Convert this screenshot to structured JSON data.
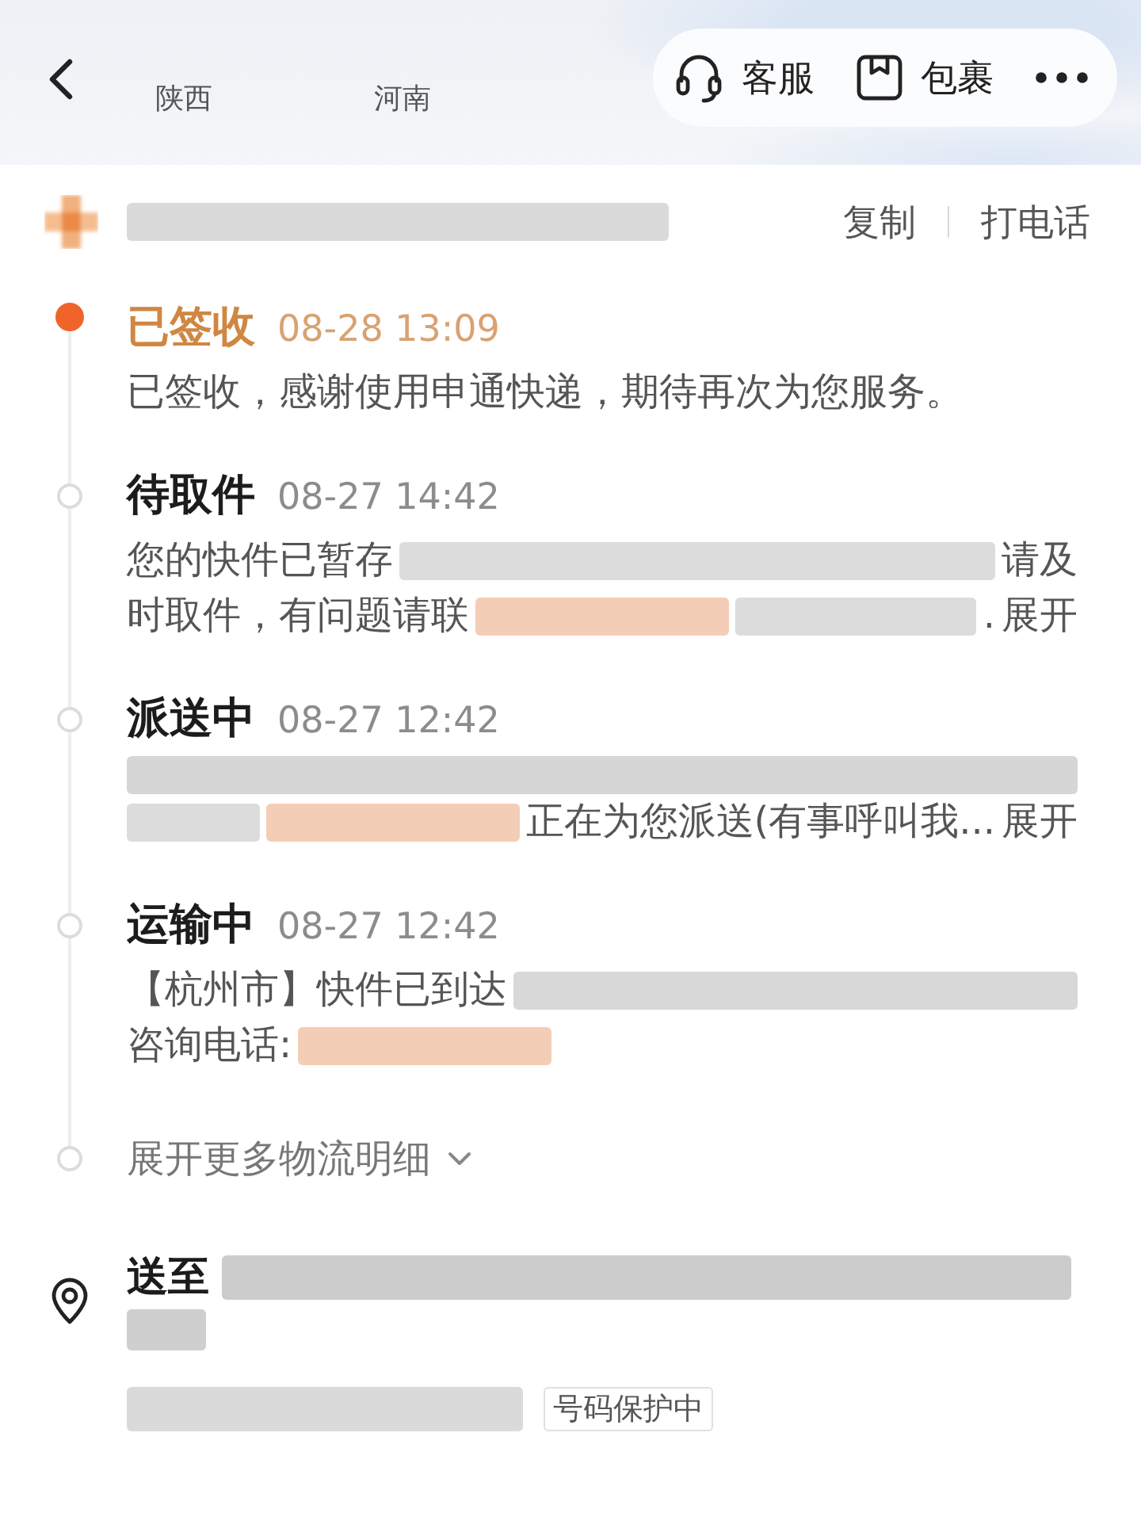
{
  "map": {
    "labels": [
      "陕西",
      "河南"
    ]
  },
  "top_bar": {
    "actions": [
      {
        "kind": "headset",
        "label": "客服"
      },
      {
        "kind": "package",
        "label": "包裹"
      }
    ]
  },
  "waybill": {
    "number": [
      {
        "kind": "blur-fill",
        "color": "#dadada"
      }
    ],
    "actions": [
      "复制",
      "打电话"
    ]
  },
  "timeline": [
    {
      "status": "已签收",
      "time": "08-28 13:09",
      "current": true,
      "lines": [
        [
          {
            "kind": "text",
            "text": "已签收，感谢使用申通快递，期待再次为您服务。"
          }
        ]
      ]
    },
    {
      "status": "待取件",
      "time": "08-27 14:42",
      "current": false,
      "lines": [
        [
          {
            "kind": "text",
            "text": "您的快件已暂存"
          },
          {
            "kind": "blur-fill",
            "color": "#dcdcdc"
          },
          {
            "kind": "text",
            "text": "请及"
          }
        ],
        [
          {
            "kind": "text",
            "text": "时取件，有问题请联"
          },
          {
            "kind": "blur-medium",
            "color": "#f4cdb6"
          },
          {
            "kind": "blur-fill",
            "color": "#dcdcdc"
          },
          {
            "kind": "text",
            "text": "."
          },
          {
            "kind": "link",
            "text": "展开"
          }
        ]
      ]
    },
    {
      "status": "派送中",
      "time": "08-27 12:42",
      "current": false,
      "lines": [
        [
          {
            "kind": "blur-fill",
            "color": "#d6d6d6"
          }
        ],
        [
          {
            "kind": "blur-fill",
            "color": "#dcdcdc"
          },
          {
            "kind": "blur-medium",
            "color": "#f4cdb6"
          },
          {
            "kind": "text",
            "text": "正在为您派送(有事呼叫我..."
          },
          {
            "kind": "link",
            "text": "展开"
          }
        ]
      ]
    },
    {
      "status": "运输中",
      "time": "08-27 12:42",
      "current": false,
      "lines": [
        [
          {
            "kind": "text",
            "text": "【杭州市】快件已到达"
          },
          {
            "kind": "blur-fill",
            "color": "#d8d8d8"
          }
        ],
        [
          {
            "kind": "text",
            "text": "咨询电话:"
          },
          {
            "kind": "blur-medium",
            "color": "#f4cdb6"
          }
        ]
      ]
    }
  ],
  "expand_more": {
    "label": "展开更多物流明细"
  },
  "address": {
    "lines": [
      [
        {
          "kind": "heading",
          "text": "送至"
        },
        {
          "kind": "blur-fill",
          "color": "#cccccc"
        }
      ],
      [
        {
          "kind": "blur-short",
          "color": "#cfcfcf"
        }
      ],
      [
        {
          "kind": "blur-long",
          "color": "#dadada"
        },
        {
          "kind": "tag",
          "text": "号码保护中"
        }
      ]
    ]
  }
}
